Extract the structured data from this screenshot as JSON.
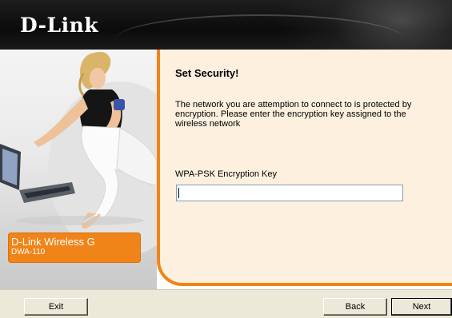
{
  "brand": {
    "logo_text": "D-Link"
  },
  "side_panel": {
    "product_name": "D-Link Wireless G",
    "product_model": "DWA-110",
    "accent_color": "#f08418"
  },
  "main": {
    "title": "Set Security!",
    "message": "The network you are attemption to connect to is protected by encryption. Please enter the encryption key assigned to the wireless network",
    "key_label": "WPA-PSK Encryption Key",
    "key_value": ""
  },
  "buttons": {
    "exit": "Exit",
    "back": "Back",
    "next": "Next"
  },
  "icons": [
    "dlink-logo",
    "product-photo"
  ]
}
